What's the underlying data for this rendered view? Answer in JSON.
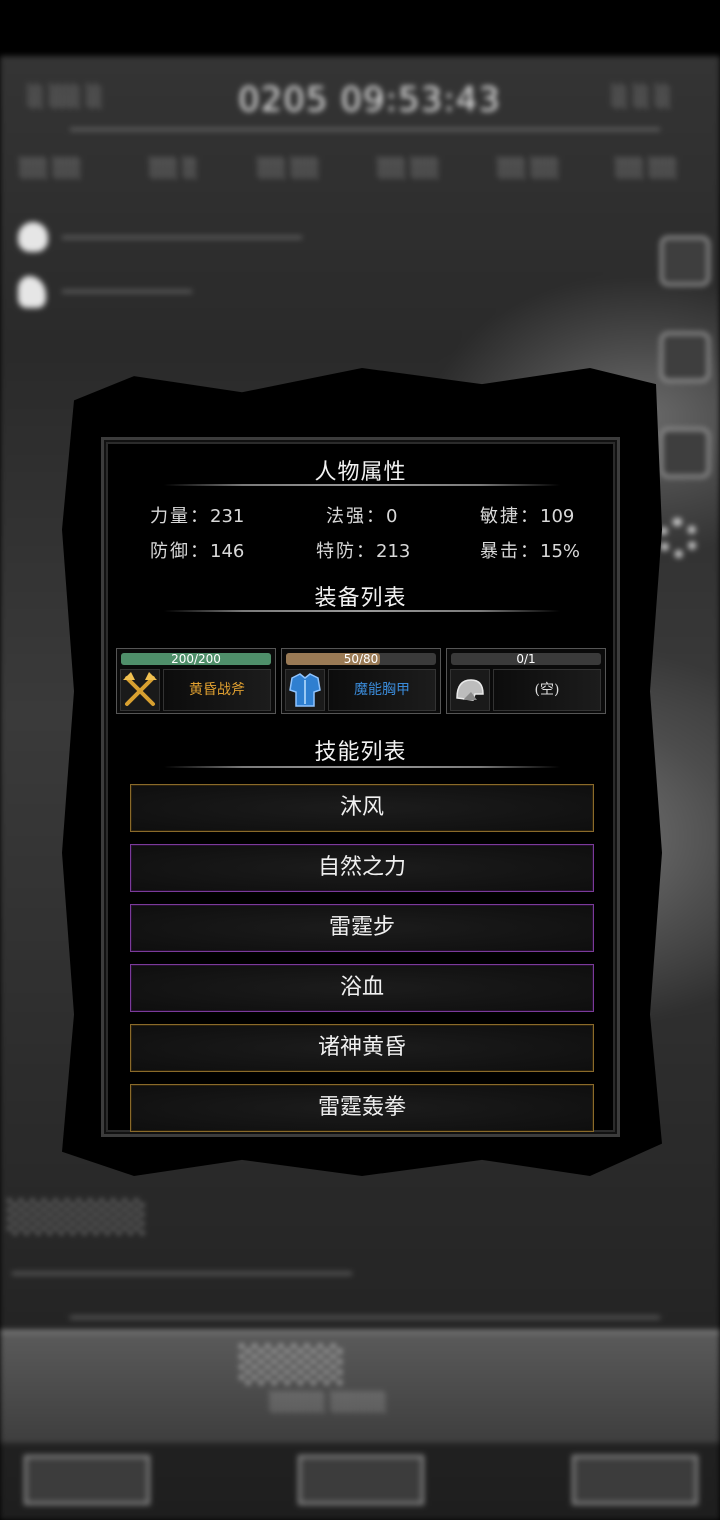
{
  "attributes": {
    "title": "人物属性",
    "items": [
      {
        "key": "力量：",
        "value": "231"
      },
      {
        "key": "法强：",
        "value": "0"
      },
      {
        "key": "敏捷：",
        "value": "109"
      },
      {
        "key": "防御：",
        "value": "146"
      },
      {
        "key": "特防：",
        "value": "213"
      },
      {
        "key": "暴击：",
        "value": "15%"
      }
    ]
  },
  "equipment": {
    "title": "装备列表",
    "items": [
      {
        "durability": "200/200",
        "durability_fraction": 1.0,
        "bar_color": "#4f8f6a",
        "name": "黄昏战斧",
        "name_color": "#e0a030",
        "icon": "golden-axes-icon"
      },
      {
        "durability": "50/80",
        "durability_fraction": 0.625,
        "bar_color": "#9a7a55",
        "name": "魔能胸甲",
        "name_color": "#3a8ad8",
        "icon": "blue-chestplate-icon"
      },
      {
        "durability": "0/1",
        "durability_fraction": 0.0,
        "bar_color": "#5a5a5a",
        "name": "(空)",
        "name_color": "#dddddd",
        "icon": "empty-helmet-icon"
      }
    ]
  },
  "skills": {
    "title": "技能列表",
    "items": [
      {
        "label": "沐风",
        "rarity_color": "#8a6a2a"
      },
      {
        "label": "自然之力",
        "rarity_color": "#7a3a9a"
      },
      {
        "label": "雷霆步",
        "rarity_color": "#7a3a9a"
      },
      {
        "label": "浴血",
        "rarity_color": "#7a3a9a"
      },
      {
        "label": "诸神黄昏",
        "rarity_color": "#8a6a2a"
      },
      {
        "label": "雷霆轰拳",
        "rarity_color": "#8a6a2a"
      }
    ]
  }
}
